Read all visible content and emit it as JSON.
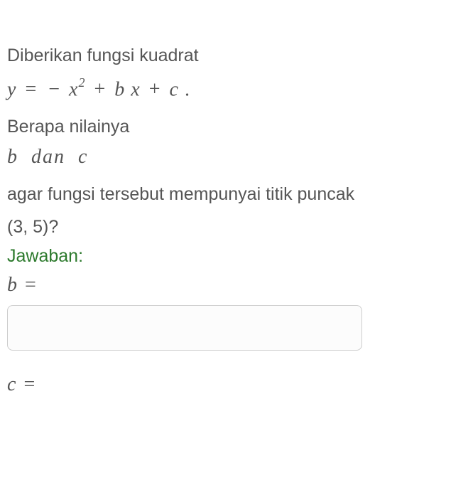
{
  "problem": {
    "intro": "Diberikan fungsi kuadrat",
    "equation_y": "y",
    "equation_eq": "=",
    "equation_neg": "−",
    "equation_x": "x",
    "equation_sq": "2",
    "equation_plus1": "+",
    "equation_b": "b",
    "equation_x2": "x",
    "equation_plus2": "+",
    "equation_c": "c",
    "equation_dot": ".",
    "question1": "Berapa nilainya",
    "vars_b": "b",
    "vars_dan": "dan",
    "vars_c": "c",
    "question2a": " agar fungsi tersebut mempunyai titik puncak",
    "vertex": "(3, 5)?",
    "answer_label": "Jawaban:",
    "label_b": "b",
    "label_b_eq": "=",
    "label_c": "c",
    "label_c_eq": "=",
    "input_b_value": "",
    "input_c_value": ""
  }
}
